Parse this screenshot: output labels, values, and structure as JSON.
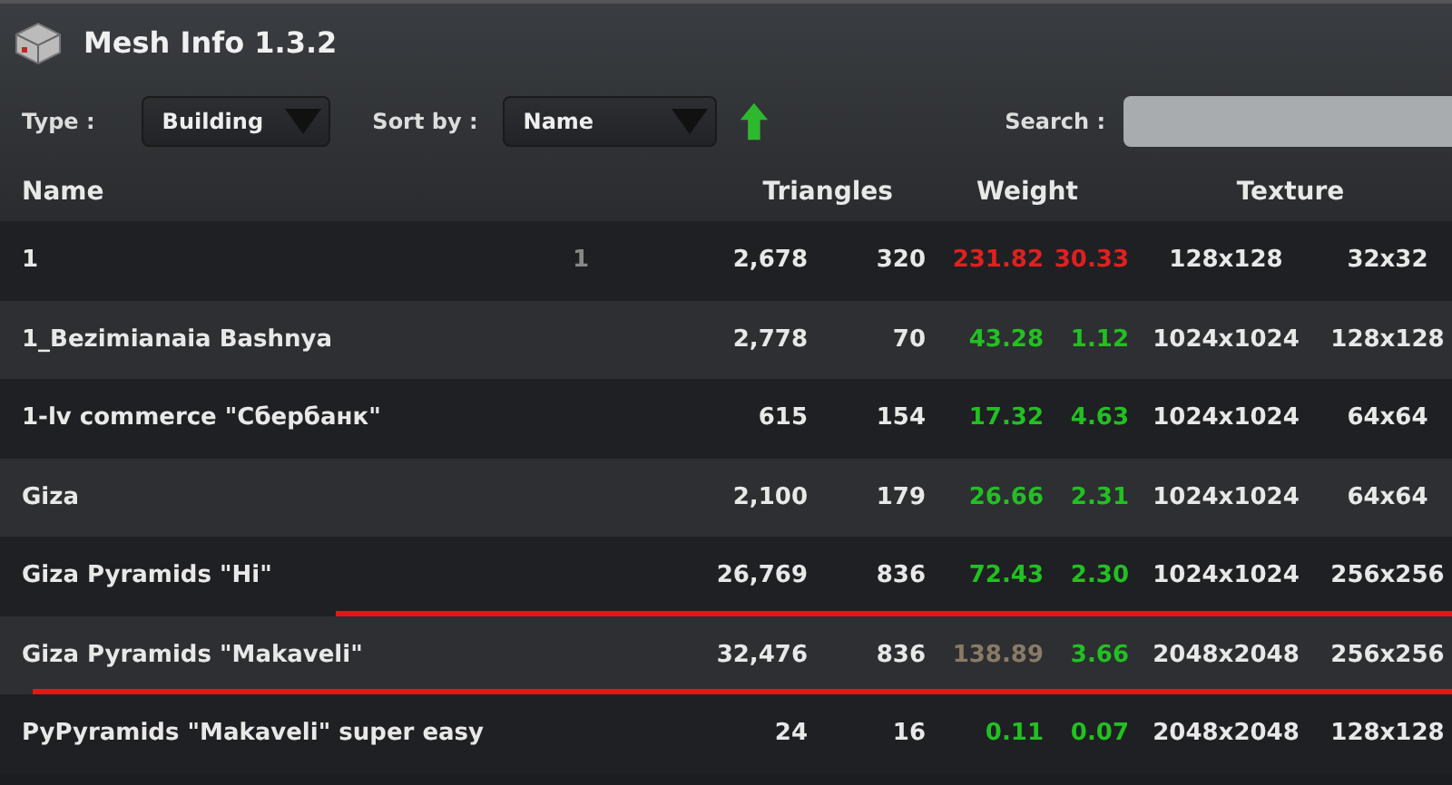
{
  "window": {
    "title": "Mesh Info 1.3.2"
  },
  "filters": {
    "type_label": "Type :",
    "type_value": "Building",
    "sort_label": "Sort by :",
    "sort_value": "Name",
    "search_label": "Search :"
  },
  "table": {
    "columns": [
      "Name",
      "Triangles",
      "Weight",
      "Texture"
    ],
    "rows": [
      {
        "name": "1",
        "column_2": "1",
        "tri_a": "2,678",
        "tri_b": "320",
        "weights": [
          {
            "value": "231.82",
            "color": "#e02020"
          },
          {
            "value": "30.33",
            "color": "#e02020"
          }
        ],
        "tex_a": "128x128",
        "tex_b": "32x32",
        "highlighted": false
      },
      {
        "name": "1_Bezimianaia Bashnya",
        "tri_a": "2,778",
        "tri_b": "70",
        "weights": [
          {
            "value": "43.28",
            "color": "#22c022"
          },
          {
            "value": "1.12",
            "color": "#22c022"
          }
        ],
        "tex_a": "1024x1024",
        "tex_b": "128x128",
        "highlighted": false
      },
      {
        "name": "1-lv commerce \"Сбербанк\"",
        "tri_a": "615",
        "tri_b": "154",
        "weights": [
          {
            "value": "17.32",
            "color": "#22c022"
          },
          {
            "value": "4.63",
            "color": "#22c022"
          }
        ],
        "tex_a": "1024x1024",
        "tex_b": "64x64",
        "highlighted": false
      },
      {
        "name": "Giza",
        "tri_a": "2,100",
        "tri_b": "179",
        "weights": [
          {
            "value": "26.66",
            "color": "#22c022"
          },
          {
            "value": "2.31",
            "color": "#22c022"
          }
        ],
        "tex_a": "1024x1024",
        "tex_b": "64x64",
        "highlighted": false
      },
      {
        "name": "Giza Pyramids \"Hi\"",
        "tri_a": "26,769",
        "tri_b": "836",
        "weights": [
          {
            "value": "72.43",
            "color": "#22c022"
          },
          {
            "value": "2.30",
            "color": "#22c022"
          }
        ],
        "tex_a": "1024x1024",
        "tex_b": "256x256",
        "highlighted": false
      },
      {
        "name": "Giza Pyramids \"Makaveli\"",
        "tri_a": "32,476",
        "tri_b": "836",
        "weights": [
          {
            "value": "138.89",
            "color": "#8a7a66"
          },
          {
            "value": "3.66",
            "color": "#22c022"
          }
        ],
        "tex_a": "2048x2048",
        "tex_b": "256x256",
        "highlighted": true
      },
      {
        "name": "PyPyramids \"Makaveli\" super easy",
        "tri_a": "24",
        "tri_b": "16",
        "weights": [
          {
            "value": "0.11",
            "color": "#22c022"
          },
          {
            "value": "0.07",
            "color": "#22c022"
          }
        ],
        "tex_a": "2048x2048",
        "tex_b": "128x128",
        "highlighted": false
      }
    ]
  }
}
